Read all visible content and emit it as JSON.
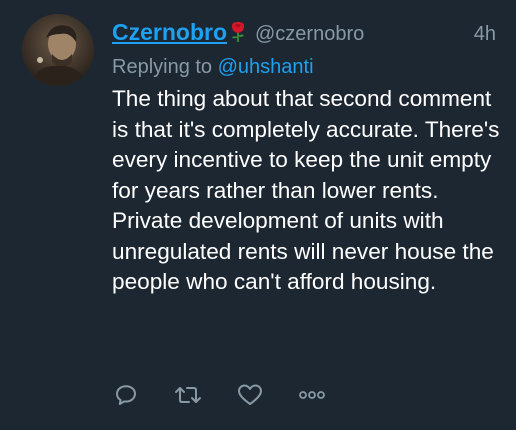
{
  "tweet": {
    "display_name": "Czernobro",
    "emoji": "rose",
    "handle": "@czernobro",
    "time": "4h",
    "replying_prefix": "Replying to ",
    "replying_to": "@uhshanti",
    "body": "The thing about that second comment is that it's completely accurate. There's every incentive to keep the unit empty for years rather than lower rents. Private development of units with unregulated rents will never house the people who can't afford housing."
  },
  "actions": [
    "reply-icon",
    "retweet-icon",
    "like-icon",
    "more-icon"
  ],
  "colors": {
    "background": "#1c2732",
    "link": "#1da1f2",
    "muted": "#8899a6",
    "text": "#ffffff",
    "icon": "#8899a6"
  }
}
